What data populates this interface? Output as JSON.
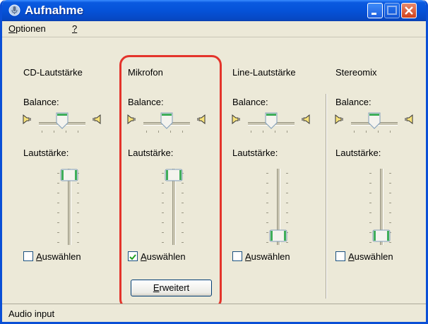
{
  "window": {
    "title": "Aufnahme",
    "controls": [
      "minimize",
      "maximize",
      "close"
    ]
  },
  "menubar": {
    "items": [
      {
        "label": "Optionen",
        "mnemonic": "O"
      },
      {
        "label": "?",
        "mnemonic": "?"
      }
    ]
  },
  "channels": [
    {
      "name": "CD-Lautstärke",
      "balance_label": "Balance:",
      "volume_label": "Lautstärke:",
      "balance": 0.5,
      "volume": 0.92,
      "select_label": "Auswählen",
      "selected": false
    },
    {
      "name": "Mikrofon",
      "balance_label": "Balance:",
      "volume_label": "Lautstärke:",
      "balance": 0.5,
      "volume": 0.92,
      "select_label": "Auswählen",
      "selected": true
    },
    {
      "name": "Line-Lautstärke",
      "balance_label": "Balance:",
      "volume_label": "Lautstärke:",
      "balance": 0.5,
      "volume": 0.12,
      "select_label": "Auswählen",
      "selected": false
    },
    {
      "name": "Stereomix",
      "balance_label": "Balance:",
      "volume_label": "Lautstärke:",
      "balance": 0.5,
      "volume": 0.12,
      "select_label": "Auswählen",
      "selected": false
    }
  ],
  "advanced_button": {
    "label": "Erweitert",
    "mnemonic": "E"
  },
  "statusbar": {
    "text": "Audio input"
  },
  "colors": {
    "titlebar": "#0552d8",
    "highlight": "#e4342b",
    "thumb_accent": "#3fae5a"
  },
  "icons": {
    "app": "microphone-icon",
    "speaker_left": "speaker-left-icon",
    "speaker_right": "speaker-right-icon"
  }
}
